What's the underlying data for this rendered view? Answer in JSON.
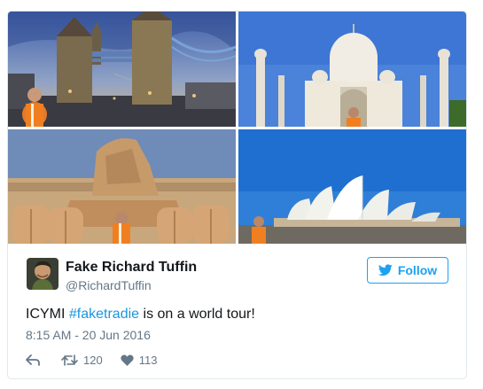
{
  "author": {
    "name": "Fake Richard Tuffin",
    "handle": "@RichardTuffin"
  },
  "follow_button": {
    "label": "Follow"
  },
  "tweet": {
    "text_prefix": "ICYMI ",
    "hashtag": "#faketradie",
    "text_suffix": " is on a world tour!",
    "timestamp": "8:15 AM - 20 Jun 2016"
  },
  "stats": {
    "retweets": "120",
    "likes": "113"
  },
  "colors": {
    "accent": "#1da1f2",
    "hashtag": "#1b95e0",
    "secondary_text": "#657786"
  },
  "icons": [
    "twitter-bird-icon",
    "reply-icon",
    "retweet-icon",
    "heart-icon"
  ]
}
